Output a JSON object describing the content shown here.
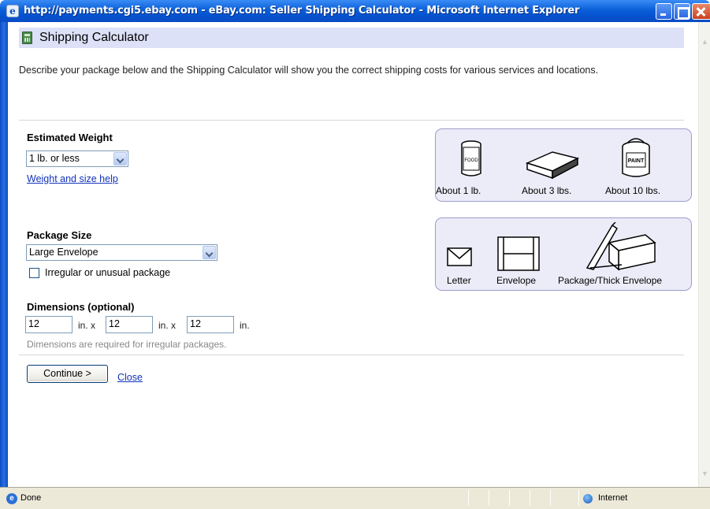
{
  "window": {
    "title": "http://payments.cgi5.ebay.com - eBay.com: Seller Shipping Calculator - Microsoft Internet Explorer"
  },
  "page": {
    "heading": "Shipping Calculator",
    "description": "Describe your package below and the Shipping Calculator will show you the correct shipping costs for various services and locations."
  },
  "weight": {
    "label": "Estimated Weight",
    "selected": "1 lb. or less",
    "help_link": "Weight and size help",
    "examples": [
      "About 1 lb.",
      "About 3 lbs.",
      "About 10 lbs."
    ],
    "icon_text": {
      "can": "FOOD",
      "bucket": "PAINT"
    }
  },
  "package": {
    "label": "Package Size",
    "selected": "Large Envelope",
    "irregular_label": "Irregular or unusual package",
    "irregular_checked": false,
    "examples": [
      "Letter",
      "Envelope",
      "Package/Thick Envelope"
    ]
  },
  "dimensions": {
    "label": "Dimensions (optional)",
    "length": "12",
    "width": "12",
    "height": "12",
    "unit_sep": "in. x",
    "unit_end": "in.",
    "hint": "Dimensions are required for irregular packages."
  },
  "actions": {
    "continue_label": "Continue >",
    "close_label": "Close"
  },
  "statusbar": {
    "status": "Done",
    "zone": "Internet"
  },
  "colors": {
    "heading_bar": "#dde1f8",
    "link": "#1133bb",
    "panel_bg": "#ececf8",
    "titlebar": "#0a5fd8"
  }
}
